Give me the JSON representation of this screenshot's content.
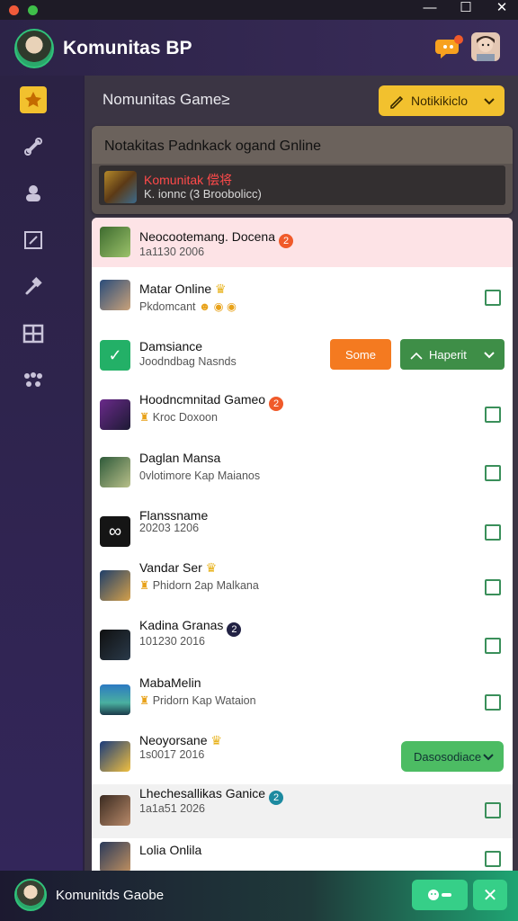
{
  "window": {
    "minimize": "—",
    "maximize": "☐",
    "close": "✕"
  },
  "header": {
    "title": "Komunitas BP"
  },
  "main": {
    "page_title": "Nomunitas Game≥",
    "notif_button": "Notikikiclo"
  },
  "card": {
    "title": "Notakitas Padnkack ogand Gnline",
    "item_name": "Komunitak 偿将",
    "item_sub": "K. ionnc (3 Broobolicc)"
  },
  "rows": [
    {
      "name": "Neocootemang. Docena",
      "sub": "1a1130 2006",
      "badge": "2",
      "badge_color": "#f05a2a",
      "highlight": true
    },
    {
      "name": "Matar Online",
      "sub": "Pkdomcant",
      "badge": "",
      "checkbox": true
    },
    {
      "name": "Damsiance",
      "sub": "Joodndbag Nasnds",
      "btn1": "Some",
      "btn2": "Haperit"
    },
    {
      "name": "Hoodncmnitad Gameo",
      "sub": "Kroc Doxoon",
      "badge": "2",
      "badge_color": "#f05a2a",
      "checkbox": true
    },
    {
      "name": "Daglan Mansa",
      "sub": "0vlotimore Kap Maianos",
      "checkbox": true
    },
    {
      "name": "Flanssname",
      "sub": "20203 1206",
      "checkbox": true
    },
    {
      "name": "Vandar Ser",
      "sub": "Phidorn 2ap Malkana",
      "checkbox": true
    },
    {
      "name": "Kadina Granas",
      "sub": "101230 2016",
      "badge": "2",
      "badge_color": "#222244",
      "checkbox": true
    },
    {
      "name": "MabaMelin",
      "sub": "Pridorn Kap Wataion",
      "checkbox": true
    },
    {
      "name": "Neoyorsane",
      "sub": "1s0017 2016",
      "btn3": "Dasosodiace"
    },
    {
      "name": "Lhechesallikas Ganice",
      "sub": "1a1a51 2026",
      "badge": "2",
      "badge_color": "#1c8aa0",
      "checkbox": true,
      "gray": true
    },
    {
      "name": "Lolia Onlila",
      "sub": "",
      "checkbox": true
    }
  ],
  "bottom": {
    "title": "Komunitds Gaobe",
    "btn1_icon": "chat-icon",
    "btn2_icon": "close-icon",
    "btn2": "✕"
  },
  "colors": {
    "accent_yellow": "#f2c12e",
    "accent_green": "#4cbc63",
    "accent_orange": "#f47a20",
    "highlight_pink": "#fde3e6"
  }
}
